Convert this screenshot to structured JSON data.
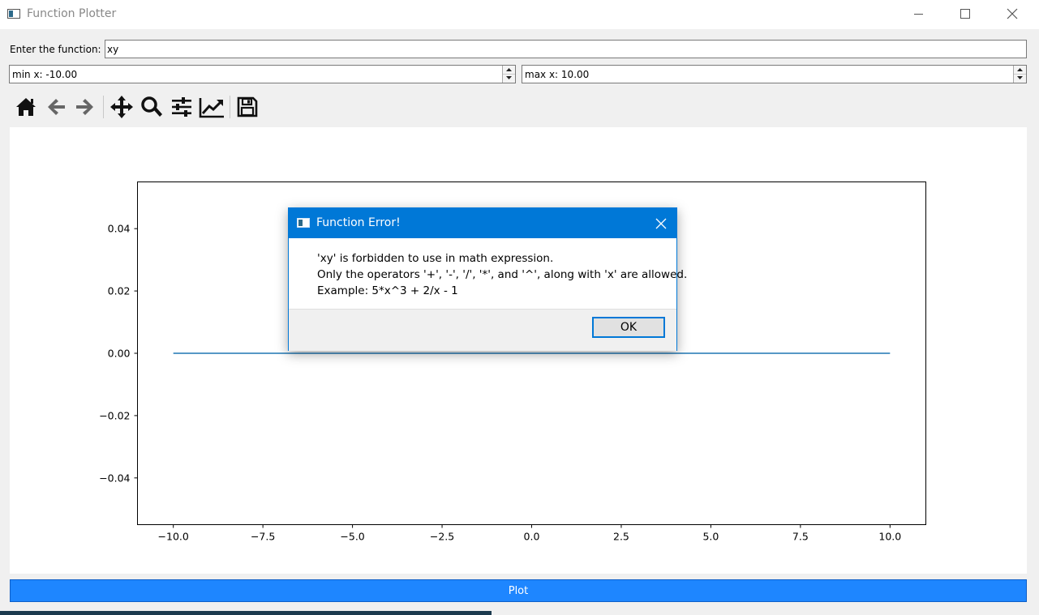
{
  "window": {
    "title": "Function Plotter"
  },
  "function_row": {
    "label": "Enter the function:",
    "value": "xy"
  },
  "min_x": {
    "label": "min x: -10.00"
  },
  "max_x": {
    "label": "max x: 10.00"
  },
  "toolbar": {
    "tools": [
      "home-icon",
      "back-arrow-icon",
      "forward-arrow-icon",
      "pan-icon",
      "zoom-icon",
      "subplot-config-icon",
      "edit-axis-icon",
      "save-icon"
    ]
  },
  "chart_data": {
    "type": "line",
    "title": "",
    "xlabel": "",
    "ylabel": "",
    "xlim": [
      -11,
      11
    ],
    "ylim": [
      -0.055,
      0.055
    ],
    "x_ticks": [
      -10,
      -7.5,
      -5,
      -2.5,
      0,
      2.5,
      5,
      7.5,
      10
    ],
    "x_tick_labels": [
      "−10.0",
      "−7.5",
      "−5.0",
      "−2.5",
      "0.0",
      "2.5",
      "5.0",
      "7.5",
      "10.0"
    ],
    "y_ticks": [
      0.04,
      0.02,
      0,
      -0.02,
      -0.04
    ],
    "y_tick_labels": [
      "0.04",
      "0.02",
      "0.00",
      "−0.02",
      "−0.04"
    ],
    "grid": false,
    "series": [
      {
        "x": [
          -10,
          10
        ],
        "y": [
          0,
          0
        ],
        "color": "#1f77b4"
      }
    ]
  },
  "plot_button": {
    "label": "Plot",
    "color": "#1e86ff"
  },
  "dialog": {
    "title": "Function Error!",
    "lines": [
      "'xy' is forbidden to use in math expression.",
      "Only the operators '+', '-', '/', '*', and '^', along with 'x' are allowed.",
      "Example: 5*x^3 + 2/x - 1"
    ],
    "ok_label": "OK",
    "accent": "#0078d7"
  }
}
